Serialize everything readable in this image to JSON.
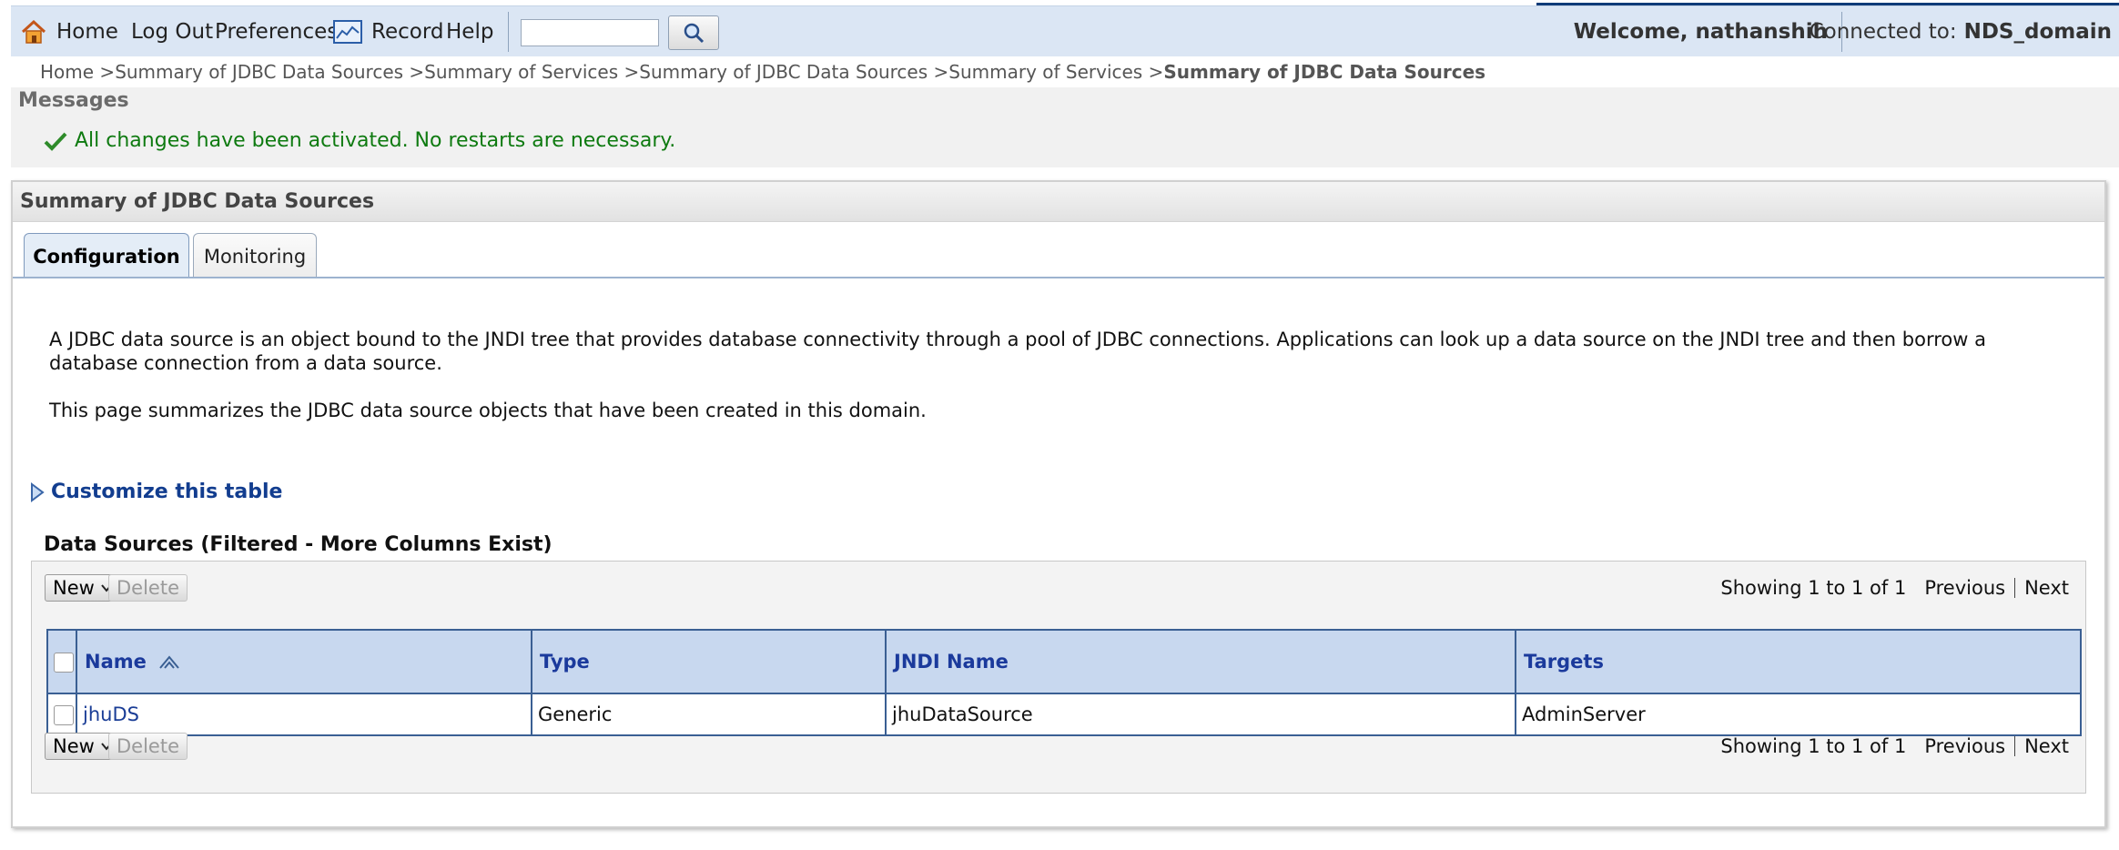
{
  "topbar": {
    "home": "Home",
    "logout": "Log Out",
    "preferences": "Preferences",
    "record": "Record",
    "help": "Help",
    "search_value": "",
    "welcome": "Welcome, nathanshih",
    "connected_label": "Connected to:",
    "domain": "NDS_domain"
  },
  "breadcrumb": {
    "items": [
      "Home >",
      "Summary of JDBC Data Sources >",
      "Summary of Services >",
      "Summary of JDBC Data Sources >",
      "Summary of Services >"
    ],
    "current": "Summary of JDBC Data Sources"
  },
  "messages": {
    "title": "Messages",
    "text": "All changes have been activated. No restarts are necessary."
  },
  "panel": {
    "title": "Summary of JDBC Data Sources",
    "tabs": [
      "Configuration",
      "Monitoring"
    ],
    "desc1": "A JDBC data source is an object bound to the JNDI tree that provides database connectivity through a pool of JDBC connections. Applications can look up a data source on the JNDI tree and then borrow a database connection from a data source.",
    "desc2": "This page summarizes the JDBC data source objects that have been created in this domain.",
    "customize": "Customize this table"
  },
  "table": {
    "title": "Data Sources (Filtered - More Columns Exist)",
    "new_label": "New",
    "delete_label": "Delete",
    "showing": "Showing 1 to 1 of 1",
    "previous": "Previous",
    "next": "Next",
    "headers": [
      "Name",
      "Type",
      "JNDI Name",
      "Targets"
    ],
    "rows": [
      {
        "name": "jhuDS",
        "type": "Generic",
        "jndi": "jhuDataSource",
        "targets": "AdminServer"
      }
    ]
  }
}
